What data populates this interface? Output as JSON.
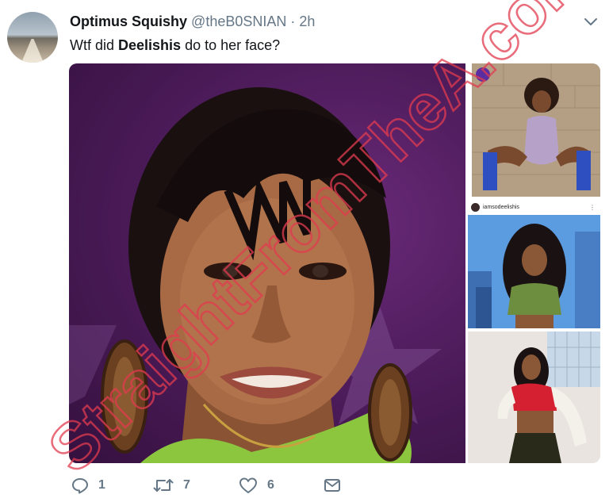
{
  "tweet": {
    "display_name": "Optimus Squishy",
    "handle": "@theB0SNIAN",
    "separator": "·",
    "time": "2h",
    "text_before": "Wtf did ",
    "text_bold": "Deelishis",
    "text_after": " do to her face?"
  },
  "media": {
    "ig_username": "iamsodeelishis",
    "ig_more": "⋮"
  },
  "actions": {
    "reply_count": "1",
    "retweet_count": "7",
    "like_count": "6"
  },
  "watermark": {
    "text": "StraightFromTheA.com",
    "color": "#e23b4f"
  },
  "colors": {
    "text_primary": "#14171a",
    "text_secondary": "#657786",
    "background": "#ffffff"
  }
}
